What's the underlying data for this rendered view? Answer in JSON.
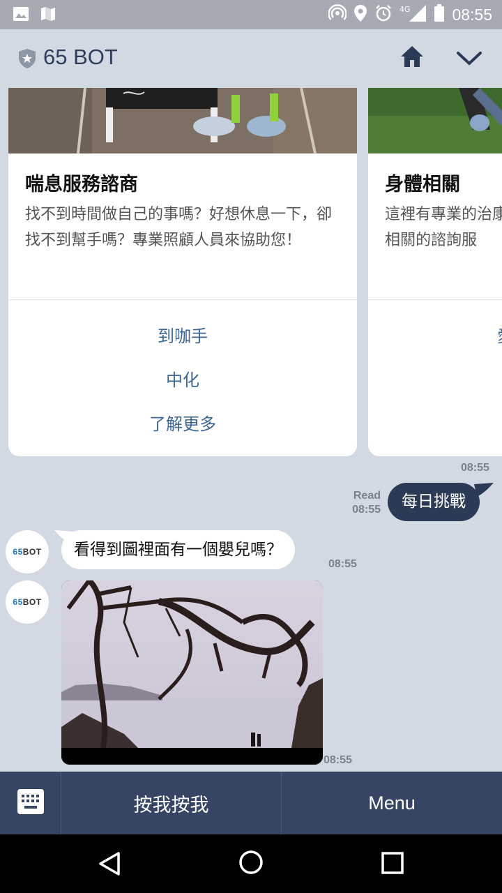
{
  "status_bar": {
    "time": "08:55",
    "network": "4G",
    "left_icons": [
      "image-icon",
      "map-icon"
    ],
    "right_icons": [
      "hotspot-icon",
      "location-icon",
      "alarm-icon",
      "signal-icon",
      "battery-icon"
    ]
  },
  "header": {
    "title": "65 BOT",
    "icons": [
      "shield-icon",
      "home-icon",
      "chevron-down-icon"
    ]
  },
  "cards": [
    {
      "title": "喘息服務諮商",
      "description": "找不到時間做自己的事嗎？好想休息一下，卻找不到幫手嗎？專業照顧人員來協助您！",
      "actions": [
        "到咖手",
        "中化",
        "了解更多"
      ]
    },
    {
      "title": "身體相關",
      "description": "這裡有專業的治康相關的諮詢服",
      "actions": [
        "愛"
      ]
    }
  ],
  "messages": {
    "carousel_time": "08:55",
    "outgoing": {
      "text": "每日挑戰",
      "read_label": "Read",
      "time": "08:55"
    },
    "incoming_text": {
      "avatar": "65BOT",
      "text": "看得到圖裡面有一個嬰兒嗎？",
      "time": "08:55"
    },
    "incoming_image": {
      "avatar": "65BOT",
      "time": "08:55"
    }
  },
  "bottom_bar": {
    "keyboard_icon": "keyboard-icon",
    "button1": "按我按我",
    "button2": "Menu"
  },
  "nav_bar": {
    "icons": [
      "back-icon",
      "home-circle-icon",
      "recents-icon"
    ]
  },
  "colors": {
    "header_bg": "#d3d9e3",
    "accent_dark": "#2b3a55",
    "bottom_bar": "#364563",
    "link": "#3e6691"
  }
}
